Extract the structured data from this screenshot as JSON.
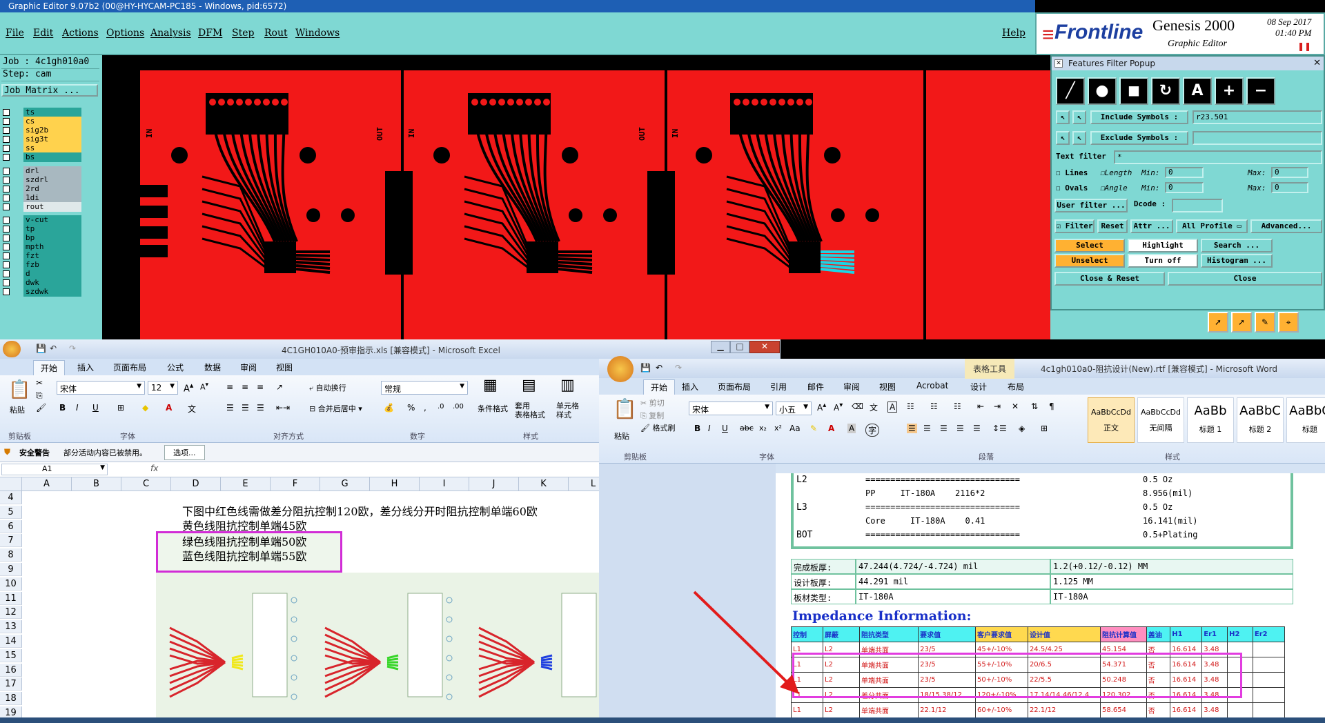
{
  "genesis": {
    "title": "Graphic Editor 9.07b2 (00@HY-HYCAM-PC185 - Windows, pid:6572)",
    "menu": [
      "File",
      "Edit",
      "Actions",
      "Options",
      "Analysis",
      "DFM",
      "Step",
      "Rout",
      "Windows"
    ],
    "help": "Help",
    "brand": "Frontline",
    "product": "Genesis 2000",
    "subtitle": "Graphic Editor",
    "date": "08 Sep 2017",
    "time": "01:40 PM",
    "job": "Job : 4c1gh010a0",
    "step": "Step: cam",
    "job_matrix": "Job Matrix ...",
    "layers": [
      {
        "name": "ts",
        "color": "#2aa59a"
      },
      {
        "name": "cs",
        "color": "#ffd24d"
      },
      {
        "name": "sig2b",
        "color": "#ffd24d"
      },
      {
        "name": "sig3t",
        "color": "#ffd24d"
      },
      {
        "name": "ss",
        "color": "#ffd24d"
      },
      {
        "name": "bs",
        "color": "#2aa59a"
      },
      {
        "name": "drl",
        "color": "#a8b8c0"
      },
      {
        "name": "szdrl",
        "color": "#a8b8c0"
      },
      {
        "name": "2rd",
        "color": "#a8b8c0"
      },
      {
        "name": "1di",
        "color": "#a8b8c0"
      },
      {
        "name": "rout",
        "color": "#dfe8ea"
      },
      {
        "name": "v-cut",
        "color": "#2aa59a"
      },
      {
        "name": "tp",
        "color": "#2aa59a"
      },
      {
        "name": "bp",
        "color": "#2aa59a"
      },
      {
        "name": "mpth",
        "color": "#2aa59a"
      },
      {
        "name": "fzt",
        "color": "#2aa59a"
      },
      {
        "name": "fzb",
        "color": "#2aa59a"
      },
      {
        "name": "d",
        "color": "#2aa59a"
      },
      {
        "name": "dwk",
        "color": "#2aa59a"
      },
      {
        "name": "szdwk",
        "color": "#2aa59a"
      }
    ],
    "canvas_labels": [
      "IN",
      "OUT",
      "IN",
      "OUT",
      "IN"
    ]
  },
  "filter": {
    "title": "Features Filter Popup",
    "include_symbols_label": "Include Symbols :",
    "include_symbols_value": "r23.501",
    "exclude_symbols_label": "Exclude Symbols :",
    "exclude_symbols_value": "",
    "text_filter_label": "Text filter",
    "text_filter_value": "*",
    "lines": "Lines",
    "ovals": "Ovals",
    "length": "Length",
    "angle": "Angle",
    "min": "Min:",
    "max": "Max:",
    "zero": "0",
    "user_filter": "User filter ...",
    "dcode": "Dcode :",
    "filter": "Filter",
    "reset": "Reset",
    "attr": "Attr ...",
    "all_profile": "All Profile",
    "advanced": "Advanced...",
    "select": "Select",
    "highlight": "Highlight",
    "search": "Search ...",
    "unselect": "Unselect",
    "turn_off": "Turn off",
    "histogram": "Histogram ...",
    "close_reset": "Close & Reset",
    "close": "Close"
  },
  "excel": {
    "title": "4C1GH010A0-预审指示.xls  [兼容模式]  -  Microsoft Excel",
    "tabs": [
      "开始",
      "插入",
      "页面布局",
      "公式",
      "数据",
      "审阅",
      "视图"
    ],
    "font": "宋体",
    "size": "12",
    "format": "常规",
    "btn_wrap": "自动换行",
    "btn_merge": "合并后居中",
    "paste": "粘贴",
    "cond_fmt": "条件格式",
    "table_fmt": "套用\n表格格式",
    "cell_style": "单元格\n样式",
    "groups": [
      "剪贴板",
      "字体",
      "对齐方式",
      "数字",
      "样式"
    ],
    "warning_title": "安全警告",
    "warning_text": "部分活动内容已被禁用。",
    "options": "选项...",
    "namebox": "A1",
    "fx": "fx",
    "columns": [
      "A",
      "B",
      "C",
      "D",
      "E",
      "F",
      "G",
      "H",
      "I",
      "J",
      "K",
      "L"
    ],
    "rows": [
      "4",
      "5",
      "6",
      "7",
      "8",
      "9",
      "10",
      "11",
      "12",
      "13",
      "14",
      "15",
      "16",
      "17",
      "18",
      "19"
    ],
    "note1": "下图中红色线需做差分阻抗控制120欧，差分线分开时阻抗控制单端60欧",
    "note2": "黄色线阻抗控制单端45欧",
    "note3": "绿色线阻抗控制单端50欧",
    "note4": "蓝色线阻抗控制单端55欧"
  },
  "word": {
    "title": "4c1gh010a0-阻抗设计(New).rtf [兼容模式] - Microsoft Word",
    "context_tab": "表格工具",
    "tabs": [
      "开始",
      "插入",
      "页面布局",
      "引用",
      "邮件",
      "审阅",
      "视图",
      "Acrobat",
      "设计",
      "布局"
    ],
    "font": "宋体",
    "size": "小五",
    "cut": "剪切",
    "copy": "复制",
    "format_painter": "格式刷",
    "paste": "粘贴",
    "styles": [
      {
        "preview": "AaBbCcDd",
        "name": "正文"
      },
      {
        "preview": "AaBbCcDd",
        "name": "无间隔"
      },
      {
        "preview": "AaBb",
        "name": "标题 1"
      },
      {
        "preview": "AaBbC",
        "name": "标题 2"
      },
      {
        "preview": "AaBbC",
        "name": "标题"
      }
    ],
    "groups": [
      "剪贴板",
      "字体",
      "段落",
      "样式"
    ],
    "stack": [
      {
        "layer": "L2",
        "desc": "===============================",
        "right": "0.5 Oz"
      },
      {
        "layer": "",
        "desc": "PP     IT-180A    2116*2",
        "right": "8.956(mil)"
      },
      {
        "layer": "L3",
        "desc": "===============================",
        "right": "0.5 Oz"
      },
      {
        "layer": "",
        "desc": "Core     IT-180A    0.41",
        "right": "16.141(mil)"
      },
      {
        "layer": "BOT",
        "desc": "===============================",
        "right": "0.5+Plating"
      }
    ],
    "board": [
      [
        "完成板厚:",
        "47.244(4.724/-4.724) mil",
        "1.2(+0.12/-0.12) MM"
      ],
      [
        "设计板厚:",
        "44.291 mil",
        "1.125 MM"
      ],
      [
        "板材类型:",
        "IT-180A",
        "IT-180A"
      ]
    ],
    "impedance_title": "Impedance Information:",
    "imp_headers": [
      "控制",
      "屏蔽",
      "阻抗类型",
      "要求值",
      "客户要求值",
      "设计值",
      "阻抗计算值",
      "盖油",
      "H1",
      "Er1",
      "H2",
      "Er2"
    ],
    "imp_rows": [
      [
        "L1",
        "L2",
        "单端共面",
        "23/5",
        "45+/-10%",
        "24.5/4.25",
        "45.154",
        "否",
        "16.614",
        "3.48",
        "",
        ""
      ],
      [
        "L1",
        "L2",
        "单端共面",
        "23/5",
        "55+/-10%",
        "20/6.5",
        "54.371",
        "否",
        "16.614",
        "3.48",
        "",
        ""
      ],
      [
        "L1",
        "L2",
        "单端共面",
        "23/5",
        "50+/-10%",
        "22/5.5",
        "50.248",
        "否",
        "16.614",
        "3.48",
        "",
        ""
      ],
      [
        "L1",
        "L2",
        "差分共面",
        "18/15.38/12",
        "120+/-10%",
        "17.14/14.46/12.4",
        "120.302",
        "否",
        "16.614",
        "3.48",
        "",
        ""
      ],
      [
        "L1",
        "L2",
        "单端共面",
        "22.1/12",
        "60+/-10%",
        "22.1/12",
        "58.654",
        "否",
        "16.614",
        "3.48",
        "",
        ""
      ]
    ]
  }
}
